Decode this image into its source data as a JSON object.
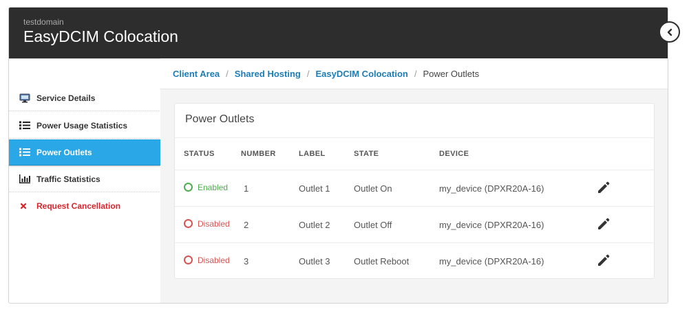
{
  "header": {
    "domain": "testdomain",
    "title": "EasyDCIM Colocation"
  },
  "sidebar": {
    "items": [
      {
        "label": "Service Details",
        "icon": "monitor-icon"
      },
      {
        "label": "Power Usage Statistics",
        "icon": "list-icon"
      },
      {
        "label": "Power Outlets",
        "icon": "list-icon",
        "active": true
      },
      {
        "label": "Traffic Statistics",
        "icon": "bar-chart-icon"
      },
      {
        "label": "Request Cancellation",
        "icon": "close-icon"
      }
    ]
  },
  "breadcrumb": {
    "items": [
      "Client Area",
      "Shared Hosting",
      "EasyDCIM Colocation"
    ],
    "separator": "/",
    "current": "Power Outlets"
  },
  "panel": {
    "title": "Power Outlets",
    "columns": [
      "STATUS",
      "NUMBER",
      "LABEL",
      "STATE",
      "DEVICE"
    ],
    "rows": [
      {
        "status": "Enabled",
        "number": "1",
        "label": "Outlet 1",
        "state": "Outlet On",
        "device": "my_device (DPXR20A-16)"
      },
      {
        "status": "Disabled",
        "number": "2",
        "label": "Outlet 2",
        "state": "Outlet Off",
        "device": "my_device (DPXR20A-16)"
      },
      {
        "status": "Disabled",
        "number": "3",
        "label": "Outlet 3",
        "state": "Outlet Reboot",
        "device": "my_device (DPXR20A-16)"
      }
    ]
  },
  "colors": {
    "header_bg": "#2d2d2d",
    "accent": "#2aa7e6",
    "link": "#1c7cb8",
    "enabled": "#4cae4c",
    "disabled": "#d9534f",
    "danger": "#d9232a"
  }
}
